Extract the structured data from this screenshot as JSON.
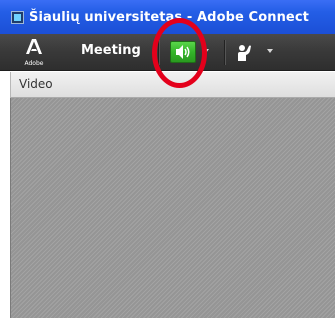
{
  "window": {
    "title": "Šiaulių universitetas - Adobe Connect"
  },
  "toolbar": {
    "logo_text": "Adobe",
    "meeting_menu_label": "Meeting",
    "icons": {
      "app": "adobe-connect-app-icon",
      "logo": "adobe-logo-icon",
      "audio": "speaker-volume-icon",
      "audio_dropdown": "chevron-down-icon",
      "raise_hand": "raise-hand-icon",
      "raise_hand_dropdown": "chevron-down-icon"
    },
    "audio_state_color": "#34b52a"
  },
  "annotation": {
    "highlight_color": "#e4001b"
  },
  "pod": {
    "title": "Video"
  },
  "colors": {
    "titlebar": "#245ee6",
    "toolbar": "#3a3a3a",
    "video_background": "#9a9a9a"
  }
}
